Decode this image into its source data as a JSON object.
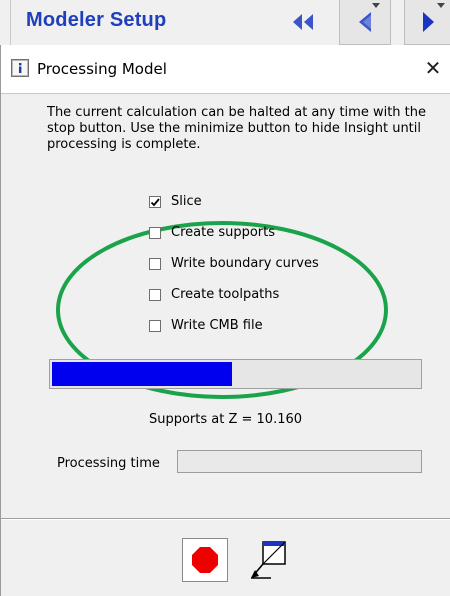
{
  "toolbar": {
    "title": "Modeler Setup",
    "icons": [
      "double-back-arrow-icon",
      "back-arrow-dropdown-icon",
      "play-arrow-dropdown-icon"
    ],
    "accent_color": "#1f3fbf"
  },
  "dialog": {
    "title": "Processing Model",
    "close_glyph": "✕",
    "description": "The current  calculation can be halted at any time with the stop button. Use  the minimize button to hide Insight until processing  is complete.",
    "steps": [
      {
        "label": "Slice",
        "checked": true
      },
      {
        "label": "Create supports",
        "checked": false
      },
      {
        "label": "Write boundary curves",
        "checked": false
      },
      {
        "label": "Create toolpaths",
        "checked": false
      },
      {
        "label": "Write CMB file",
        "checked": false
      }
    ],
    "progress_fraction": 0.49,
    "progress_color": "#0000ee",
    "status_text": "Supports at Z = 10.160",
    "processing_time_label": "Processing time",
    "processing_time_value": "",
    "annotation_color": "#1aa34a",
    "stop_color": "#ee0000"
  }
}
